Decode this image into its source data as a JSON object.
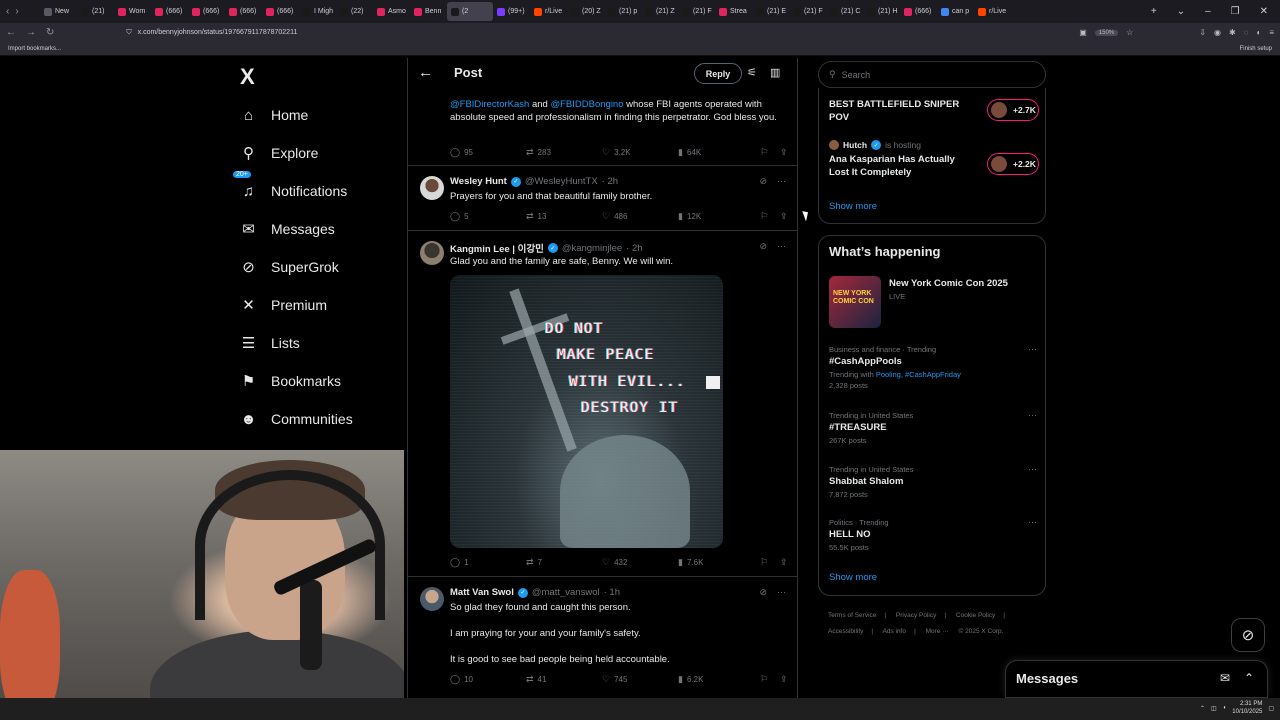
{
  "browser": {
    "tabs": [
      {
        "label": "New",
        "color": "#5a5a66"
      },
      {
        "label": "(21)",
        "color": "#1a1a1a"
      },
      {
        "label": "Wom",
        "color": "#e0245e"
      },
      {
        "label": "(666)",
        "color": "#e0245e"
      },
      {
        "label": "(666)",
        "color": "#e0245e"
      },
      {
        "label": "(666)",
        "color": "#e0245e"
      },
      {
        "label": "(666)",
        "color": "#e0245e"
      },
      {
        "label": "I Migh",
        "color": "#1a1a1a"
      },
      {
        "label": "(22)",
        "color": "#1a1a1a"
      },
      {
        "label": "Asmo",
        "color": "#e0245e"
      },
      {
        "label": "Benn",
        "color": "#e0245e"
      },
      {
        "label": "(2",
        "color": "#1a1a1a",
        "active": true
      },
      {
        "label": "(99+)",
        "color": "#7a3cff"
      },
      {
        "label": "r/Live",
        "color": "#ff4500"
      },
      {
        "label": "(20) Z",
        "color": "#1a1a1a"
      },
      {
        "label": "(21) p",
        "color": "#1a1a1a"
      },
      {
        "label": "(21) Z",
        "color": "#1a1a1a"
      },
      {
        "label": "(21) F",
        "color": "#1a1a1a"
      },
      {
        "label": "Strea",
        "color": "#e0245e"
      },
      {
        "label": "(21) E",
        "color": "#1a1a1a"
      },
      {
        "label": "(21) F",
        "color": "#1a1a1a"
      },
      {
        "label": "(21) C",
        "color": "#1a1a1a"
      },
      {
        "label": "(21) H",
        "color": "#1a1a1a"
      },
      {
        "label": "(666)",
        "color": "#e0245e"
      },
      {
        "label": "can p",
        "color": "#4285f4"
      },
      {
        "label": "r/Live",
        "color": "#ff4500"
      }
    ],
    "url": "x.com/bennyjohnson/status/1976679117878702211",
    "zoom": "150%",
    "bookmark_import": "Import bookmarks...",
    "finish_setup": "Finish setup"
  },
  "nav": {
    "logo": "X",
    "items": [
      {
        "label": "Home",
        "icon": "home-icon",
        "glyph": "⌂"
      },
      {
        "label": "Explore",
        "icon": "search-icon",
        "glyph": "⚲"
      },
      {
        "label": "Notifications",
        "icon": "bell-icon",
        "glyph": "♫",
        "badge": "20+"
      },
      {
        "label": "Messages",
        "icon": "mail-icon",
        "glyph": "✉"
      },
      {
        "label": "SuperGrok",
        "icon": "grok-icon",
        "glyph": "⊘"
      },
      {
        "label": "Premium",
        "icon": "x-premium-icon",
        "glyph": "✕"
      },
      {
        "label": "Lists",
        "icon": "list-icon",
        "glyph": "☰"
      },
      {
        "label": "Bookmarks",
        "icon": "bookmark-icon",
        "glyph": "⚑"
      },
      {
        "label": "Communities",
        "icon": "people-icon",
        "glyph": "☻"
      }
    ]
  },
  "header": {
    "title": "Post",
    "reply_label": "Reply"
  },
  "tweets": {
    "first_text_links": [
      "@FBIDirectorKash",
      "@FBIDDBongino"
    ],
    "first_text_and": " and ",
    "first_text_rest": " whose FBI agents operated with absolute speed and professionalism in finding this perpetrator. God bless you.",
    "first_stats": {
      "replies": "95",
      "reposts": "283",
      "likes": "3.2K",
      "views": "64K"
    },
    "wesley": {
      "name": "Wesley Hunt",
      "handle": "@WesleyHuntTX",
      "time": "· 2h",
      "text": "Prayers for you and that beautiful family brother.",
      "stats": {
        "replies": "5",
        "reposts": "13",
        "likes": "486",
        "views": "12K"
      }
    },
    "kangmin": {
      "name": "Kangmin Lee | 이강민",
      "handle": "@kangminjlee",
      "time": "· 2h",
      "text": "Glad you and the family are safe, Benny. We will win.",
      "image_lines": [
        "DO NOT",
        "MAKE PEACE",
        "WITH EVIL...",
        "DESTROY IT"
      ],
      "stats": {
        "replies": "1",
        "reposts": "7",
        "likes": "432",
        "views": "7.6K"
      }
    },
    "matt": {
      "name": "Matt Van Swol",
      "handle": "@matt_vanswol",
      "time": "· 1h",
      "text1": "So glad they found and caught this person.",
      "text2": "I am praying for your and your family's safety.",
      "text3": "It is good to see bad people being held accountable.",
      "stats": {
        "replies": "10",
        "reposts": "41",
        "likes": "745",
        "views": "6.2K"
      }
    }
  },
  "right": {
    "search_placeholder": "Search",
    "spaces": [
      {
        "title": "BEST BATTLEFIELD SNIPER POV",
        "count": "+2.7K"
      },
      {
        "host": "Hutch",
        "host_status": "is hosting",
        "title": "Ana Kasparian Has Actually Lost It Completely",
        "count": "+2.2K"
      }
    ],
    "spaces_show_more": "Show more",
    "happening_title": "What’s happening",
    "event": {
      "title": "New York Comic Con 2025",
      "status": "LIVE",
      "thumb_text": "NEW YORK COMIC CON"
    },
    "trends": [
      {
        "meta": "Business and finance · Trending",
        "name": "#CashAppPools",
        "trending_with_label": "Trending with ",
        "trending_with": "Pooling, #CashAppFriday",
        "count": "2,328 posts"
      },
      {
        "meta": "Trending in United States",
        "name": "#TREASURE",
        "count": "267K posts"
      },
      {
        "meta": "Trending in United States",
        "name": "Shabbat Shalom",
        "count": "7,872 posts"
      },
      {
        "meta": "Politics · Trending",
        "name": "HELL NO",
        "count": "55.5K posts"
      }
    ],
    "trends_show_more": "Show more",
    "footer": [
      "Terms of Service",
      "|",
      "Privacy Policy",
      "|",
      "Cookie Policy",
      "|",
      "Accessibility",
      "|",
      "Ads info",
      "|",
      "More ···",
      "© 2025 X Corp."
    ]
  },
  "messages_drawer": {
    "title": "Messages"
  },
  "taskbar": {
    "time": "2:31 PM",
    "date": "10/10/2025"
  },
  "colors": {
    "accent": "#1d9bf0",
    "live_pink": "#f91880",
    "muted": "#71767b"
  }
}
